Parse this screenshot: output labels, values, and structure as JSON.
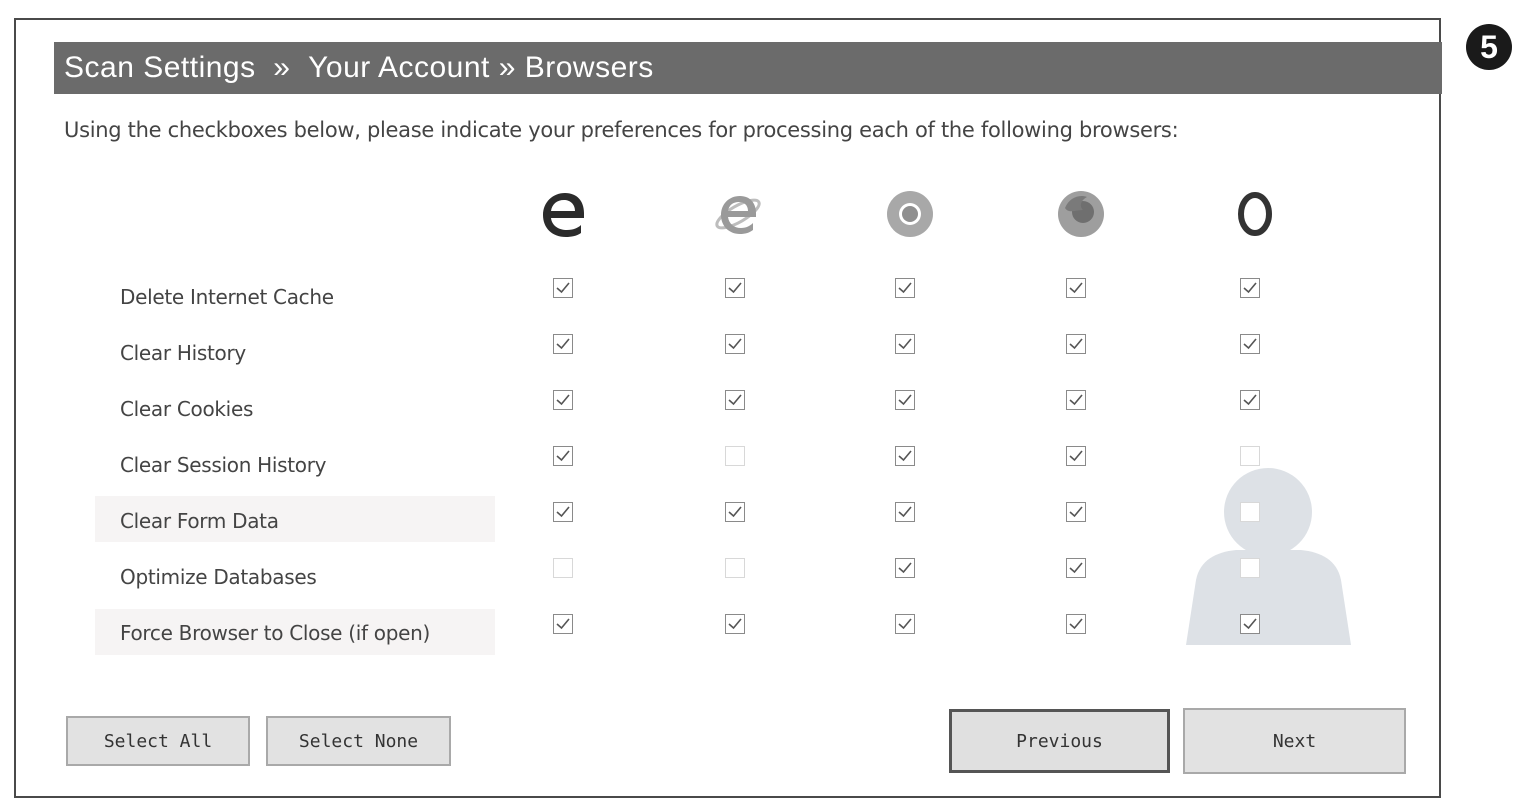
{
  "header": {
    "crumb1": "Scan Settings",
    "sep1": "  »  ",
    "crumb2": "Your Account",
    "sep2": " » ",
    "crumb3": "Browsers"
  },
  "step_number": "5",
  "instructions": "Using the checkboxes below, please indicate your preferences for processing each of the following browsers:",
  "browsers": [
    {
      "icon": "edge-icon"
    },
    {
      "icon": "internet-explorer-icon"
    },
    {
      "icon": "chrome-icon"
    },
    {
      "icon": "firefox-icon"
    },
    {
      "icon": "opera-icon"
    }
  ],
  "rows": [
    {
      "label": "Delete Internet Cache",
      "checks": [
        true,
        true,
        true,
        true,
        true
      ]
    },
    {
      "label": "Clear History",
      "checks": [
        true,
        true,
        true,
        true,
        true
      ]
    },
    {
      "label": "Clear Cookies",
      "checks": [
        true,
        true,
        true,
        true,
        true
      ]
    },
    {
      "label": "Clear Session History",
      "checks": [
        true,
        false,
        true,
        true,
        false
      ]
    },
    {
      "label": "Clear Form Data",
      "checks": [
        true,
        true,
        true,
        true,
        false
      ]
    },
    {
      "label": "Optimize Databases",
      "checks": [
        false,
        false,
        true,
        true,
        false
      ]
    },
    {
      "label": "Force Browser to Close (if open)",
      "checks": [
        true,
        true,
        true,
        true,
        true
      ]
    }
  ],
  "buttons": {
    "select_all": "Select All",
    "select_none": "Select None",
    "previous": "Previous",
    "next": "Next"
  },
  "colors": {
    "header_bg": "#6b6b6b",
    "checkbox_border": "#8a8a8a",
    "button_bg": "#e2e2e2"
  }
}
